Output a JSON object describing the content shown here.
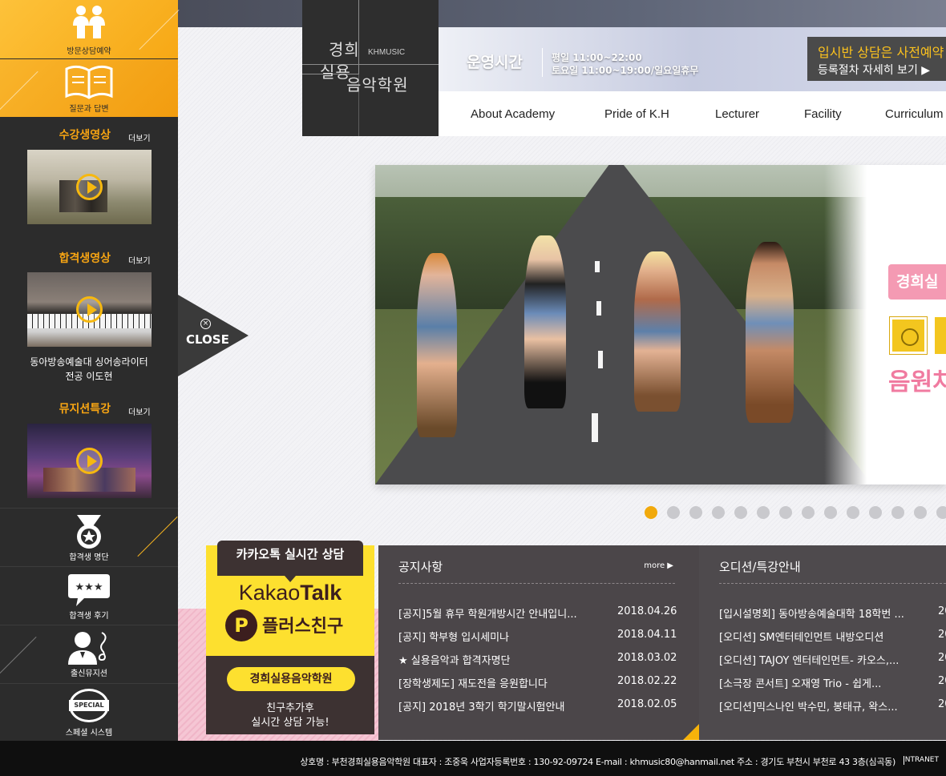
{
  "sidebar": {
    "visit_label": "방문상담예약",
    "qa_label": "질문과 답변",
    "student_videos": {
      "title": "수강생영상",
      "more": "더보기"
    },
    "pass_videos": {
      "title": "합격생영상",
      "more": "더보기",
      "caption_line1": "동아방송예술대 싱어송라이터",
      "caption_line2": "전공 이도현"
    },
    "musician_lecture": {
      "title": "뮤지션특강",
      "more": "더보기"
    },
    "hall_of_fame_label": "합격생 명단",
    "reviews_label": "합격생 후기",
    "alumni_label": "출신뮤지션",
    "special_label": "스페셜 시스템",
    "special_badge": "SPECIAL"
  },
  "close_tab": {
    "label": "CLOSE"
  },
  "logo": {
    "name_line1": "경희",
    "name_line2": "실용",
    "name_line3": "음악학원",
    "english": "KHMUSIC"
  },
  "hours": {
    "title": "운영시간",
    "weekday": "평일 11:00~22:00",
    "weekend": "토요일 11:00~19:00/일요일휴무"
  },
  "enroll": {
    "line1": "입시반 상담은 사전예약",
    "line2": "등록절차 자세히 보기  ▶"
  },
  "nav": {
    "items": [
      "About Academy",
      "Pride of K.H",
      "Lecturer",
      "Facility",
      "Curriculum"
    ]
  },
  "hero": {
    "pill_text": "경희실",
    "pink_text": "음원차"
  },
  "carousel": {
    "total_dots": 14,
    "active_index": 0
  },
  "kakao": {
    "tab": "카카오톡 실시간 상담",
    "brand_regular": "Kakao",
    "brand_bold": "Talk",
    "plus_icon": "P",
    "plus_text": "플러스친구",
    "academy_name": "경희실용음악학원",
    "line1": "친구추가후",
    "line2": "실시간 상담 가능!"
  },
  "notice": {
    "title": "공지사항",
    "more": "more ▶",
    "rows": [
      {
        "title": "[공지]5월 휴무 학원개방시간 안내입니...",
        "date": "2018.04.26"
      },
      {
        "title": "[공지] 학부형 입시세미나",
        "date": "2018.04.11"
      },
      {
        "title": "★ 실용음악과 합격자명단",
        "date": "2018.03.02"
      },
      {
        "title": "[장학생제도] 재도전을 응원합니다",
        "date": "2018.02.22"
      },
      {
        "title": "[공지] 2018년 3학기 학기말시험안내",
        "date": "2018.02.05"
      }
    ]
  },
  "audition": {
    "title": "오디션/특강안내",
    "rows": [
      {
        "title": "[입시설명회] 동아방송예술대학 18학번 ...",
        "date": "20"
      },
      {
        "title": "[오디션] SM엔터테인먼트 내방오디션",
        "date": "20"
      },
      {
        "title": "[오디션] TAJOY 엔터테인먼트- 카오스,...",
        "date": "20"
      },
      {
        "title": "[소극장 콘서트] 오재영 Trio - 쉽게...",
        "date": "20"
      },
      {
        "title": "[오디션]믹스나인 박수민, 봉태규, 왁스...",
        "date": "20"
      }
    ]
  },
  "footer": {
    "info": "상호명 : 부천경희실용음악학원   대표자 : 조중욱   사업자등록번호 : 130-92-09724  E-mail : khmusic80@hanmail.net  주소 : 경기도 부천시 부천로 43 3층(심곡동)",
    "intranet": "INTRANET"
  },
  "colors": {
    "accent_yellow": "#f6a413",
    "kakao_yellow": "#fde02f",
    "dark": "#2c2c2c",
    "board": "#4b4649"
  },
  "icons": [
    "people-icon",
    "book-icon",
    "play-icon",
    "medal-icon",
    "chat-stars-icon",
    "musician-icon",
    "special-badge-icon",
    "close-x-icon",
    "kakao-plus-icon"
  ]
}
